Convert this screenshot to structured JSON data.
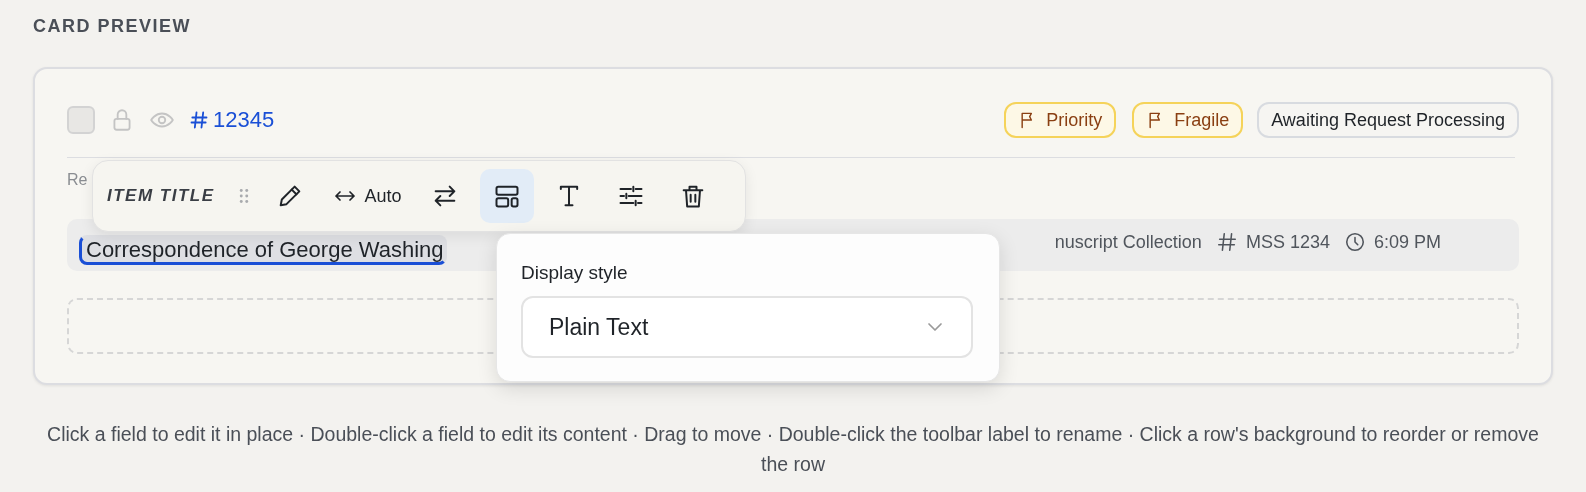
{
  "heading": "CARD PREVIEW",
  "card": {
    "checkbox": {
      "checked": false
    },
    "id": "12345",
    "tags": [
      {
        "label": "Priority",
        "kind": "flag"
      },
      {
        "label": "Fragile",
        "kind": "flag"
      },
      {
        "label": "Awaiting Request Processing",
        "kind": "status"
      }
    ],
    "row_label": "Re",
    "title_row": {
      "title": "Correspondence of George Washing",
      "editing": true,
      "collection": "nuscript Collection",
      "call_number": "MSS 1234",
      "time": "6:09 PM"
    }
  },
  "toolbar": {
    "label": "ITEM TITLE",
    "tools": [
      {
        "kind": "drag",
        "selected": false
      },
      {
        "kind": "pencil",
        "selected": false
      },
      {
        "kind": "width",
        "text": "Auto",
        "selected": false
      },
      {
        "kind": "swap",
        "selected": false
      },
      {
        "kind": "layout",
        "selected": true
      },
      {
        "kind": "text",
        "selected": false
      },
      {
        "kind": "sliders",
        "selected": false
      },
      {
        "kind": "trash",
        "selected": false
      }
    ]
  },
  "popover": {
    "label": "Display style",
    "value": "Plain Text"
  },
  "hint": "Click a field to edit it in place · Double-click a field to edit its content · Drag to move · Double-click the toolbar label to rename · Click a row's background to reorder or remove the row"
}
